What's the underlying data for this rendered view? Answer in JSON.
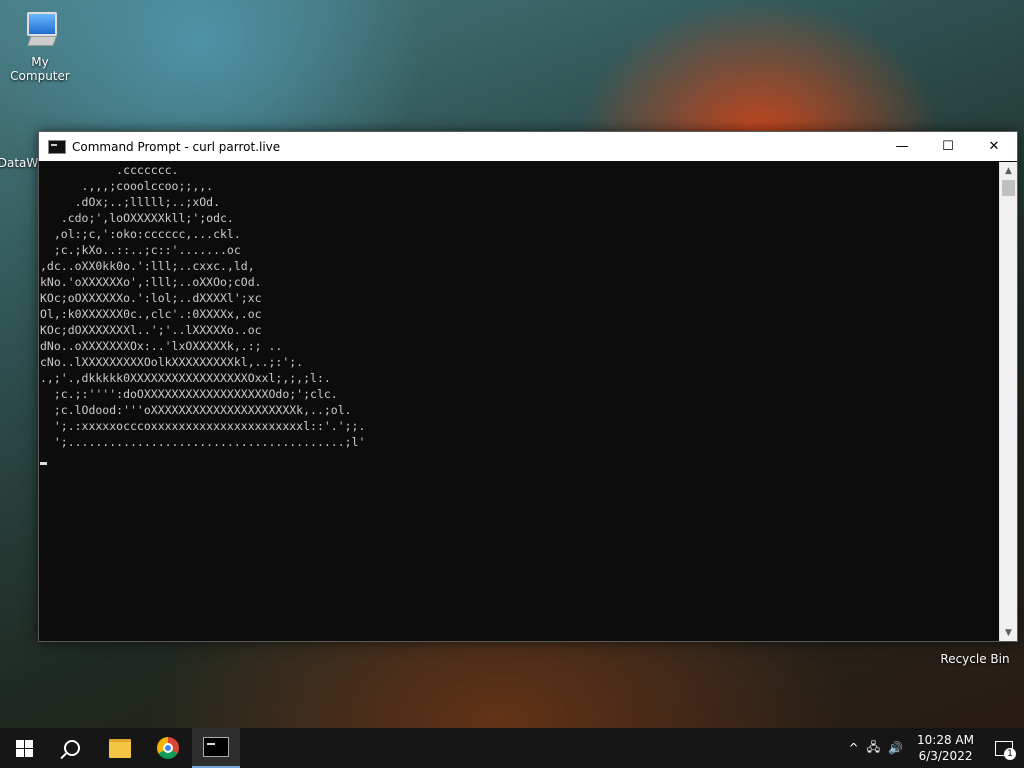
{
  "desktop": {
    "icons": [
      {
        "label": "My Computer"
      },
      {
        "label": "DataW"
      },
      {
        "label": "Recycle Bin"
      }
    ]
  },
  "window": {
    "title": "Command Prompt - curl  parrot.live",
    "minimize": "—",
    "maximize": "☐",
    "close": "✕"
  },
  "console": {
    "lines": [
      "           .ccccccc.",
      "      .,,,;cooolccoo;;,,.",
      "     .dOx;..;lllll;..;xOd.",
      "   .cdo;',loOXXXXXkll;';odc.",
      "  ,ol:;c,':oko:cccccc,...ckl.",
      "  ;c.;kXo..::..;c::'.......oc",
      ",dc..oXX0kk0o.':lll;..cxxc.,ld,",
      "kNo.'oXXXXXXo',:lll;..oXXOo;cOd.",
      "KOc;oOXXXXXXo.':lol;..dXXXXl';xc",
      "Ol,:k0XXXXXX0c.,clc'.:0XXXXx,.oc",
      "KOc;dOXXXXXXXl..';'..lXXXXXo..oc",
      "dNo..oXXXXXXXOx:..'lxOXXXXXk,.:; ..",
      "cNo..lXXXXXXXXXOolkXXXXXXXXXkl,..;:';.",
      ".,;'.,dkkkkk0XXXXXXXXXXXXXXXXXOxxl;,;,;l:.",
      "  ;c.;:'''':doOXXXXXXXXXXXXXXXXXXOdo;';clc.",
      "  ;c.lOdood:'''oXXXXXXXXXXXXXXXXXXXXXk,..;ol.",
      "  ';.:xxxxxocccoxxxxxxxxxxxxxxxxxxxxxxl::'.';;.",
      "  ';........................................;l'"
    ]
  },
  "scrollbar": {
    "up": "▲",
    "down": "▼"
  },
  "taskbar": {
    "clock_time": "10:28 AM",
    "clock_date": "6/3/2022",
    "notification_count": "1",
    "tray_chevron": "^",
    "tray_network": "🖧",
    "tray_volume": "🔊"
  }
}
